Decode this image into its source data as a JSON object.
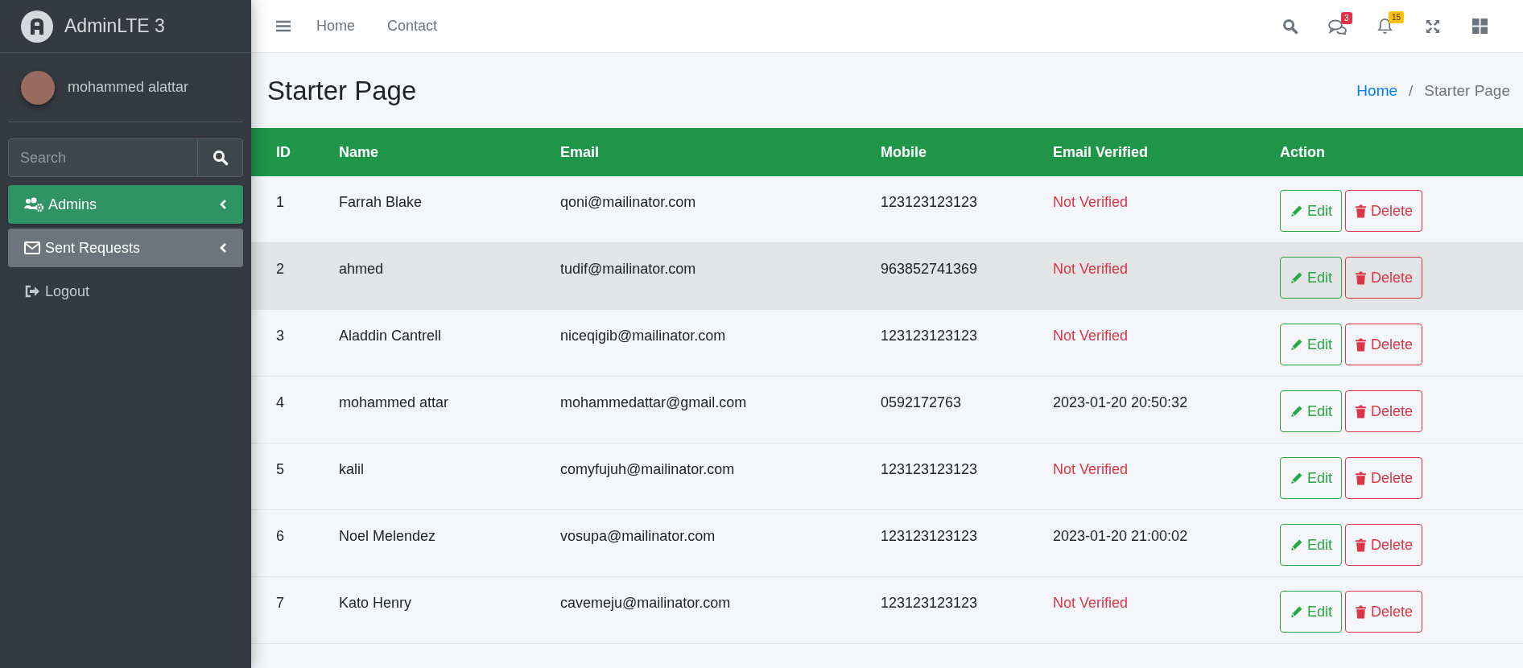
{
  "brand": {
    "title": "AdminLTE 3"
  },
  "user": {
    "name": "mohammed alattar"
  },
  "sidebar_search": {
    "placeholder": "Search"
  },
  "sidebar_items": [
    {
      "kind": "admins",
      "label": "Admins",
      "active": true,
      "hovered": false,
      "has_submenu": true
    },
    {
      "kind": "requests",
      "label": "Sent Requests",
      "active": false,
      "hovered": true,
      "has_submenu": true
    },
    {
      "kind": "logout",
      "label": "Logout",
      "active": false,
      "hovered": false,
      "has_submenu": false
    }
  ],
  "navbar": {
    "links": [
      "Home",
      "Contact"
    ],
    "icons": [
      {
        "kind": "search"
      },
      {
        "kind": "messages",
        "badge": "3",
        "color": "#dc3545"
      },
      {
        "kind": "notifications",
        "badge": "15",
        "color": "#ffc107"
      },
      {
        "kind": "fullscreen"
      },
      {
        "kind": "apps"
      }
    ]
  },
  "page_title": "Starter Page",
  "breadcrumb": [
    {
      "label": "Home",
      "link": true
    },
    {
      "label": "Starter Page",
      "link": false
    }
  ],
  "breadcrumb_separator": "/",
  "table": {
    "columns": [
      "ID",
      "Name",
      "Email",
      "Mobile",
      "Email Verified",
      "Action"
    ],
    "rows": [
      {
        "id": "1",
        "name": "Farrah Blake",
        "email": "qoni@mailinator.com",
        "mobile": "123123123123",
        "email_verified": "Not Verified",
        "verified": false,
        "hovered": false,
        "edit": "Edit",
        "delete": "Delete"
      },
      {
        "id": "2",
        "name": "ahmed",
        "email": "tudif@mailinator.com",
        "mobile": "963852741369",
        "email_verified": "Not Verified",
        "verified": false,
        "hovered": true,
        "edit": "Edit",
        "delete": "Delete"
      },
      {
        "id": "3",
        "name": "Aladdin Cantrell",
        "email": "niceqigib@mailinator.com",
        "mobile": "123123123123",
        "email_verified": "Not Verified",
        "verified": false,
        "hovered": false,
        "edit": "Edit",
        "delete": "Delete"
      },
      {
        "id": "4",
        "name": "mohammed attar",
        "email": "mohammedattar@gmail.com",
        "mobile": "0592172763",
        "email_verified": "2023-01-20 20:50:32",
        "verified": true,
        "hovered": false,
        "edit": "Edit",
        "delete": "Delete"
      },
      {
        "id": "5",
        "name": "kalil",
        "email": "comyfujuh@mailinator.com",
        "mobile": "123123123123",
        "email_verified": "Not Verified",
        "verified": false,
        "hovered": false,
        "edit": "Edit",
        "delete": "Delete"
      },
      {
        "id": "6",
        "name": "Noel Melendez",
        "email": "vosupa@mailinator.com",
        "mobile": "123123123123",
        "email_verified": "2023-01-20 21:00:02",
        "verified": true,
        "hovered": false,
        "edit": "Edit",
        "delete": "Delete"
      },
      {
        "id": "7",
        "name": "Kato Henry",
        "email": "cavemeju@mailinator.com",
        "mobile": "123123123123",
        "email_verified": "Not Verified",
        "verified": false,
        "hovered": false,
        "edit": "Edit",
        "delete": "Delete"
      }
    ]
  }
}
